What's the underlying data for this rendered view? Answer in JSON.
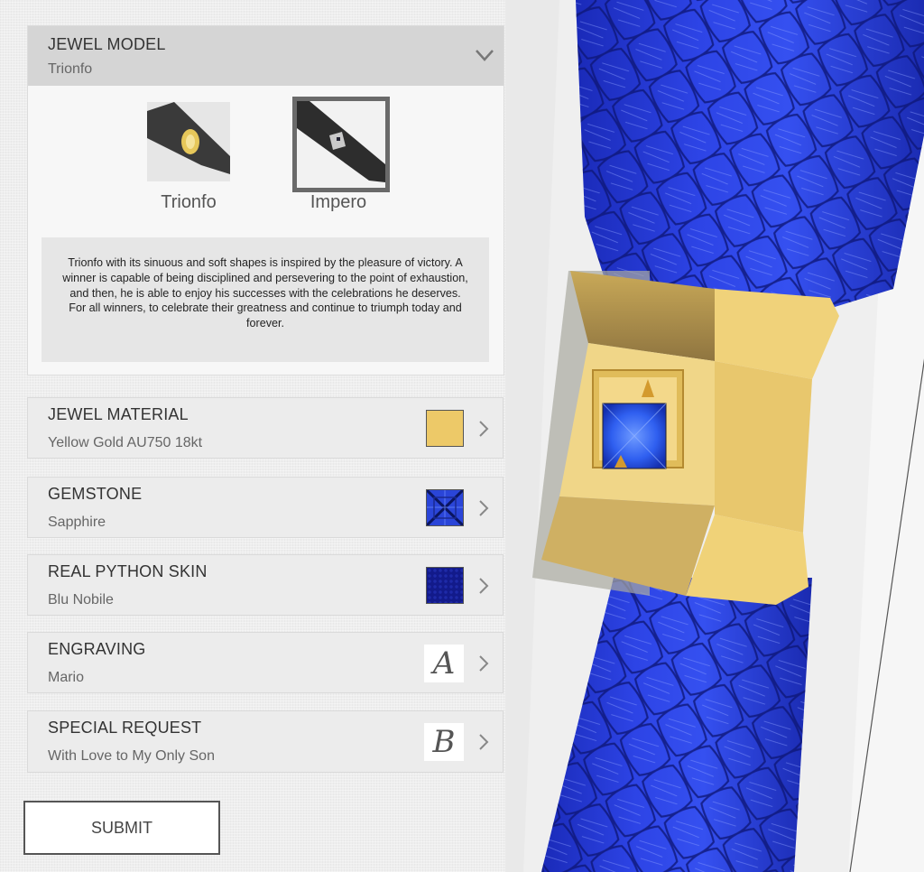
{
  "configurator": {
    "jewel_model": {
      "title": "JEWEL MODEL",
      "value": "Trionfo",
      "expanded": true,
      "options": [
        {
          "label": "Trionfo",
          "selected": false,
          "accent": "#e3c45a"
        },
        {
          "label": "Impero",
          "selected": true,
          "accent": "#c8c8c8"
        }
      ],
      "description": "Trionfo with its sinuous and soft shapes is inspired by the pleasure of victory. A winner is capable of being disciplined and persevering to the point of exhaustion, and then, he is able to enjoy his successes with the celebrations he deserves.\nFor all winners, to celebrate their greatness and continue to triumph today and forever."
    },
    "jewel_material": {
      "title": "JEWEL MATERIAL",
      "value": "Yellow Gold AU750 18kt",
      "swatch_color": "#edc968"
    },
    "gemstone": {
      "title": "GEMSTONE",
      "value": "Sapphire",
      "swatch_color": "#2a3fd0"
    },
    "python_skin": {
      "title": "REAL PYTHON SKIN",
      "value": "Blu Nobile",
      "swatch_color": "#121a8a"
    },
    "engraving": {
      "title": "ENGRAVING",
      "value": "Mario",
      "glyph": "A"
    },
    "special_request": {
      "title": "SPECIAL REQUEST",
      "value": "With Love to My Only Son",
      "glyph": "B"
    },
    "submit_label": "SUBMIT"
  },
  "preview": {
    "skin_color": "#2436d6",
    "gold_color": "#e8c86a",
    "gem_color": "#2f5ff0"
  },
  "icons": {
    "collapse": "chevron-down-icon",
    "option_arrow": "chevron-right-icon"
  }
}
